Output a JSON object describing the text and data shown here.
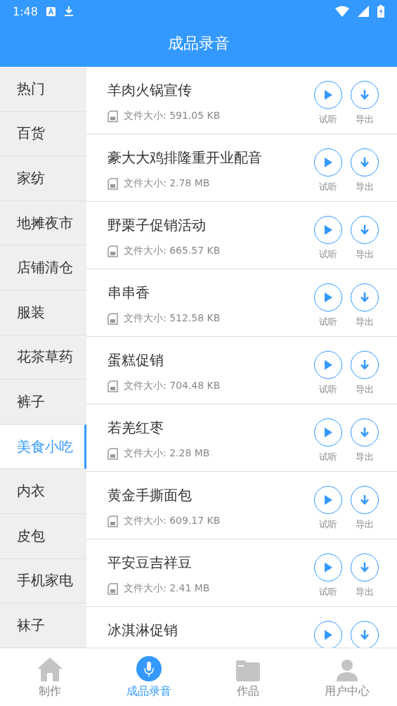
{
  "status_bar": {
    "time": "1:48"
  },
  "header": {
    "title": "成品录音"
  },
  "categories": [
    {
      "label": "热门",
      "selected": false
    },
    {
      "label": "百货",
      "selected": false
    },
    {
      "label": "家纺",
      "selected": false
    },
    {
      "label": "地摊夜市",
      "selected": false
    },
    {
      "label": "店铺清仓",
      "selected": false
    },
    {
      "label": "服装",
      "selected": false
    },
    {
      "label": "花茶草药",
      "selected": false
    },
    {
      "label": "裤子",
      "selected": false
    },
    {
      "label": "美食小吃",
      "selected": true
    },
    {
      "label": "内衣",
      "selected": false
    },
    {
      "label": "皮包",
      "selected": false
    },
    {
      "label": "手机家电",
      "selected": false
    },
    {
      "label": "袜子",
      "selected": false
    }
  ],
  "recordings": [
    {
      "title": "羊肉火锅宣传",
      "size": "文件大小: 591.05 KB",
      "listen_label": "试听",
      "export_label": "导出"
    },
    {
      "title": "豪大大鸡排隆重开业配音",
      "size": "文件大小: 2.78 MB",
      "listen_label": "试听",
      "export_label": "导出"
    },
    {
      "title": "野栗子促销活动",
      "size": "文件大小: 665.57 KB",
      "listen_label": "试听",
      "export_label": "导出"
    },
    {
      "title": "串串香",
      "size": "文件大小: 512.58 KB",
      "listen_label": "试听",
      "export_label": "导出"
    },
    {
      "title": "蛋糕促销",
      "size": "文件大小: 704.48 KB",
      "listen_label": "试听",
      "export_label": "导出"
    },
    {
      "title": "若羌红枣",
      "size": "文件大小: 2.28 MB",
      "listen_label": "试听",
      "export_label": "导出"
    },
    {
      "title": "黄金手撕面包",
      "size": "文件大小: 609.17 KB",
      "listen_label": "试听",
      "export_label": "导出"
    },
    {
      "title": "平安豆吉祥豆",
      "size": "文件大小: 2.41 MB",
      "listen_label": "试听",
      "export_label": "导出"
    },
    {
      "title": "冰淇淋促销"
    }
  ],
  "bottom_nav": [
    {
      "kind": "home",
      "label": "制作",
      "selected": false
    },
    {
      "kind": "mic",
      "label": "成品录音",
      "selected": true
    },
    {
      "kind": "folder",
      "label": "作品",
      "selected": false
    },
    {
      "kind": "user",
      "label": "用户中心",
      "selected": false
    }
  ]
}
